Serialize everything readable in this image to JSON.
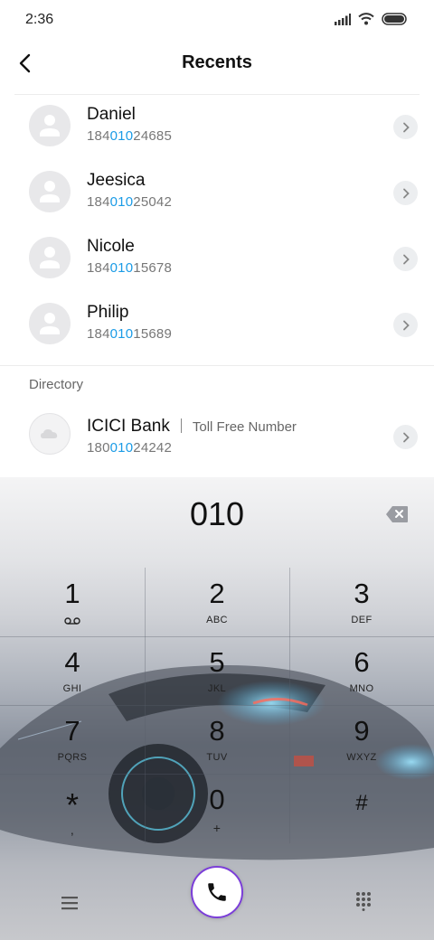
{
  "status_bar": {
    "time": "2:36"
  },
  "header": {
    "title": "Recents"
  },
  "recents": [
    {
      "name": "Daniel",
      "number_pre": "184",
      "number_match": "010",
      "number_post": "24685"
    },
    {
      "name": "Jeesica",
      "number_pre": "184",
      "number_match": "010",
      "number_post": "25042"
    },
    {
      "name": "Nicole",
      "number_pre": "184",
      "number_match": "010",
      "number_post": "15678"
    },
    {
      "name": "Philip",
      "number_pre": "184",
      "number_match": "010",
      "number_post": "15689"
    }
  ],
  "directory": {
    "label": "Directory",
    "entry": {
      "name": "ICICI Bank",
      "subtitle": "Toll Free Number",
      "number_pre": "180",
      "number_match": "010",
      "number_post": "24242"
    }
  },
  "dialer": {
    "input_value": "010",
    "keys": [
      {
        "digit": "1",
        "letters": ""
      },
      {
        "digit": "2",
        "letters": "ABC"
      },
      {
        "digit": "3",
        "letters": "DEF"
      },
      {
        "digit": "4",
        "letters": "GHI"
      },
      {
        "digit": "5",
        "letters": "JKL"
      },
      {
        "digit": "6",
        "letters": "MNO"
      },
      {
        "digit": "7",
        "letters": "PQRS"
      },
      {
        "digit": "8",
        "letters": "TUV"
      },
      {
        "digit": "9",
        "letters": "WXYZ"
      },
      {
        "digit": "*",
        "letters": ","
      },
      {
        "digit": "0",
        "letters": "+"
      },
      {
        "digit": "#",
        "letters": ""
      }
    ]
  },
  "icons": {
    "back": "back-arrow-icon",
    "chevron": "chevron-right-icon",
    "backspace": "backspace-icon",
    "voicemail": "voicemail-icon",
    "menu": "menu-icon",
    "call": "phone-icon",
    "keypad": "dialpad-icon"
  },
  "colors": {
    "highlight": "#1a9be6",
    "call_ring": "#7b3ed8"
  }
}
